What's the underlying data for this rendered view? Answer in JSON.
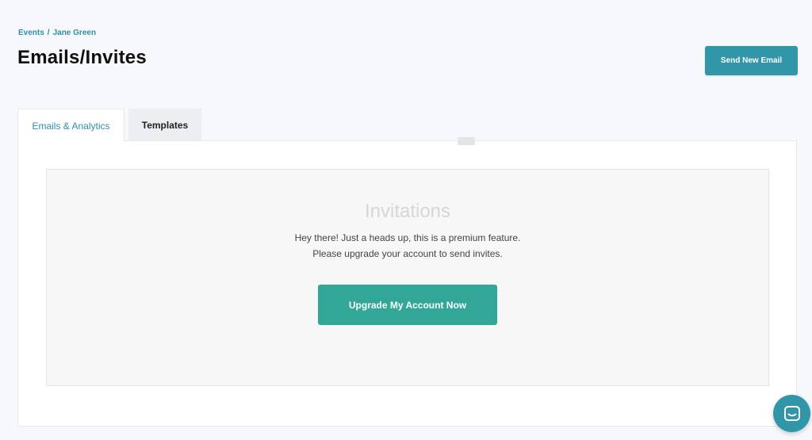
{
  "breadcrumb": {
    "items": [
      "Events",
      "Jane Green"
    ],
    "separator": "/"
  },
  "header": {
    "title": "Emails/Invites",
    "send_button_label": "Send New Email"
  },
  "tabs": [
    {
      "label": "Emails & Analytics",
      "active": true
    },
    {
      "label": "Templates",
      "active": false
    }
  ],
  "premium_notice": {
    "title": "Invitations",
    "line1": "Hey there! Just a heads up, this is a premium feature.",
    "line2": "Please upgrade your account to send invites.",
    "button_label": "Upgrade My Account Now"
  },
  "chat": {
    "icon": "chat-icon"
  },
  "colors": {
    "accent": "#3196a8",
    "upgrade": "#33a797",
    "background": "#f7f8fb"
  }
}
